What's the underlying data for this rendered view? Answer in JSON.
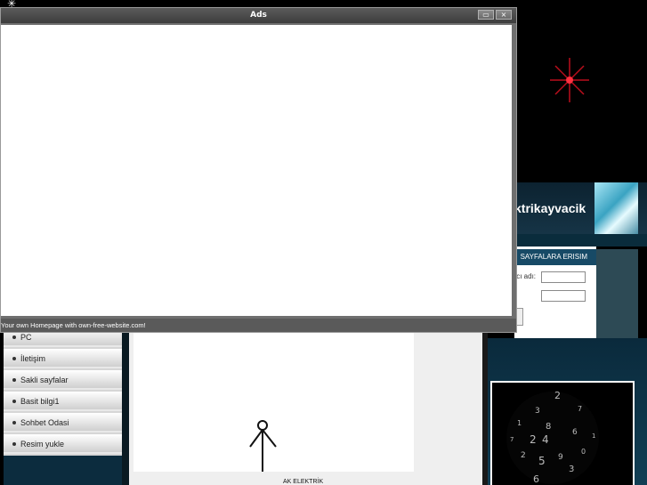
{
  "ads_window": {
    "title": "Ads",
    "status_text": "Your own Homepage with own-free-website.com!",
    "minimize_glyph": "▭",
    "close_glyph": "×"
  },
  "site": {
    "title_fragment": "ktrikayvacik",
    "login": {
      "header": "SAYFALARA ERISIM",
      "username_label": "ıcı adı:"
    },
    "menu": [
      {
        "label": "PC"
      },
      {
        "label": "İletişim"
      },
      {
        "label": "Sakli sayfalar"
      },
      {
        "label": "Basit bilgi1"
      },
      {
        "label": "Sohbet Odasi"
      },
      {
        "label": "Resim yukle"
      }
    ],
    "footer_text": "AK ELEKTRİK"
  },
  "colors": {
    "background": "#000000",
    "accent_red": "#d01020",
    "panel_blue": "#174a66"
  }
}
